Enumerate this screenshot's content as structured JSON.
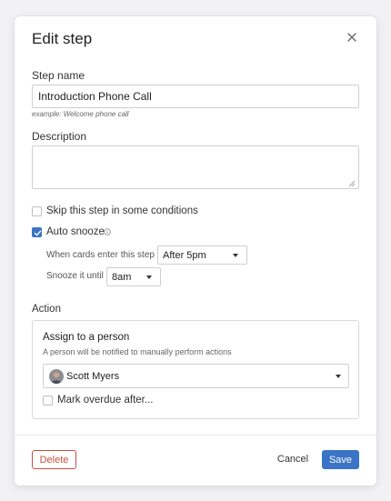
{
  "dialog": {
    "title": "Edit step",
    "close_icon": "close-icon"
  },
  "step_name": {
    "label": "Step name",
    "value": "Introduction Phone Call",
    "hint": "example: Welcome phone call"
  },
  "description": {
    "label": "Description",
    "value": ""
  },
  "skip_conditions": {
    "label": "Skip this step in some conditions",
    "checked": false
  },
  "auto_snooze": {
    "label": "Auto snooze",
    "checked": true,
    "info_icon": "info-icon",
    "when_label": "When cards enter this step",
    "when_value": "After 5pm",
    "until_label": "Snooze it until",
    "until_value": "8am"
  },
  "action": {
    "section_label": "Action",
    "title": "Assign to a person",
    "subtitle": "A person will be notified to manually perform actions",
    "person": "Scott Myers",
    "overdue_label": "Mark overdue after...",
    "overdue_checked": false
  },
  "footer": {
    "delete_label": "Delete",
    "cancel_label": "Cancel",
    "save_label": "Save"
  },
  "colors": {
    "primary": "#3b73c7",
    "danger": "#c9503f"
  }
}
